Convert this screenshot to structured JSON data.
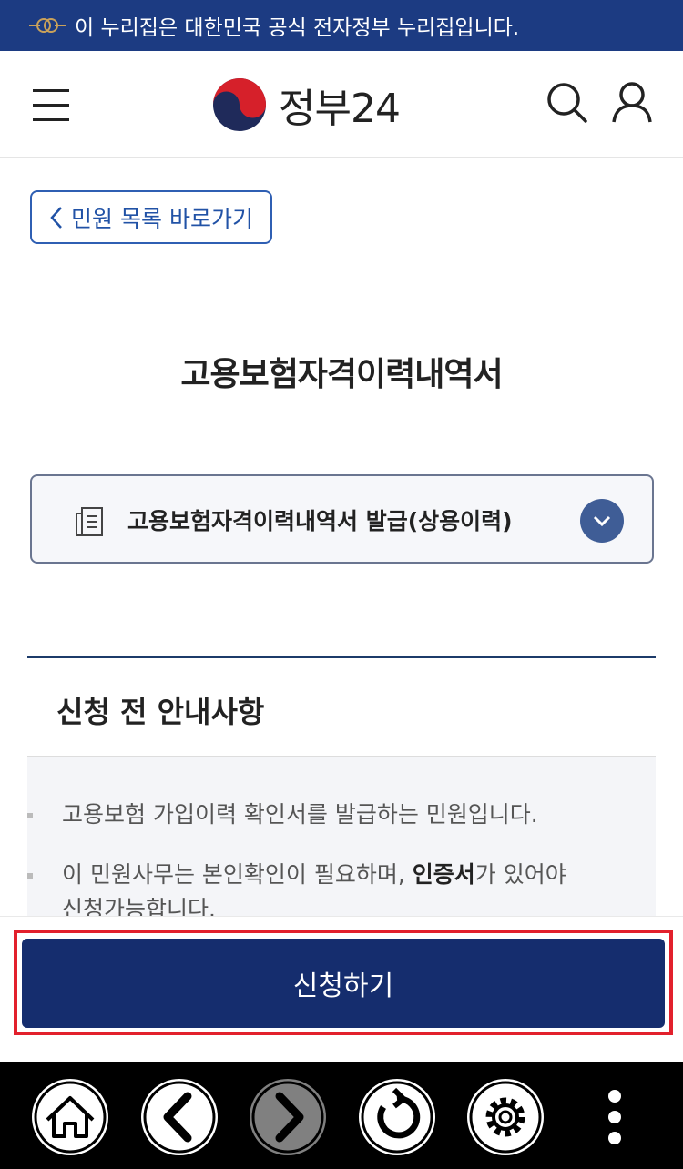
{
  "gov_banner": {
    "text": "이 누리집은 대한민국 공식 전자정부 누리집입니다."
  },
  "header": {
    "logo_text": "정부24",
    "menu_icon": "hamburger-icon",
    "search_icon": "search-icon",
    "user_icon": "user-icon"
  },
  "back_link": {
    "label": "민원 목록 바로가기"
  },
  "page": {
    "title": "고용보험자격이력내역서"
  },
  "service_select": {
    "selected": "고용보험자격이력내역서 발급(상용이력)"
  },
  "notice": {
    "heading": "신청 전 안내사항",
    "items": [
      {
        "text": "고용보험 가입이력 확인서를 발급하는 민원입니다."
      },
      {
        "pre": "이 민원사무는 본인확인이 필요하며, ",
        "bold": "인증서",
        "post": "가 있어야",
        "line2": "신청가능합니다."
      }
    ]
  },
  "apply": {
    "label": "신청하기"
  },
  "colors": {
    "banner": "#1c3b82",
    "primary_button": "#152d6e",
    "highlight": "#e2202c",
    "link": "#2152a6"
  },
  "nav_bar": {
    "icons": [
      "home-icon",
      "back-icon",
      "forward-icon",
      "refresh-icon",
      "settings-icon",
      "more-icon"
    ]
  }
}
